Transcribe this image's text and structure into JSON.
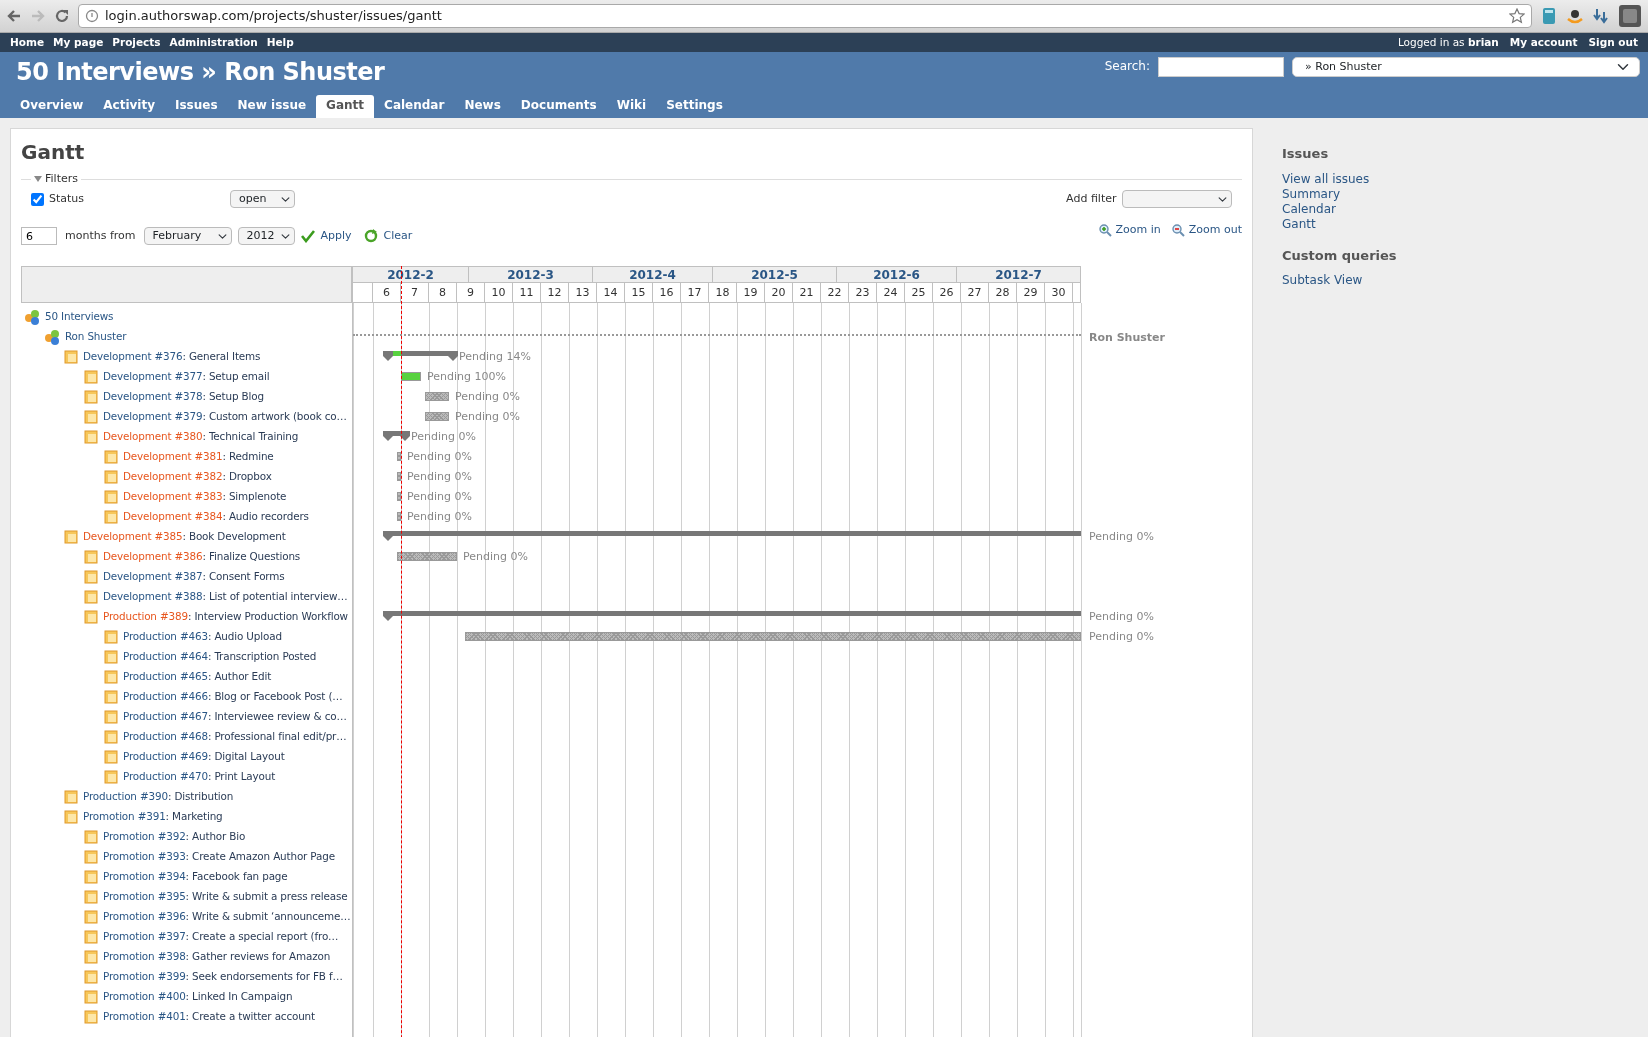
{
  "browser": {
    "url": "login.authorswap.com/projects/shuster/issues/gantt"
  },
  "top_menu": {
    "items": [
      "Home",
      "My page",
      "Projects",
      "Administration",
      "Help"
    ],
    "logged_in": "Logged in as **brian**",
    "account_items": [
      "My account",
      "Sign out"
    ]
  },
  "header": {
    "title": "50 Interviews » Ron Shuster",
    "search_label": "Search:",
    "project_jump": "» Ron Shuster"
  },
  "tabs": [
    {
      "label": "Overview",
      "selected": false
    },
    {
      "label": "Activity",
      "selected": false
    },
    {
      "label": "Issues",
      "selected": false
    },
    {
      "label": "New issue",
      "selected": false
    },
    {
      "label": "Gantt",
      "selected": true
    },
    {
      "label": "Calendar",
      "selected": false
    },
    {
      "label": "News",
      "selected": false
    },
    {
      "label": "Documents",
      "selected": false
    },
    {
      "label": "Wiki",
      "selected": false
    },
    {
      "label": "Settings",
      "selected": false
    }
  ],
  "page": {
    "title": "Gantt",
    "filters": {
      "legend": "Filters",
      "expanded": true,
      "status": {
        "label": "Status",
        "checked": true,
        "value": "open"
      },
      "add_filter_label": "Add filter"
    },
    "range": {
      "count": "6",
      "label": "months from",
      "month": "February",
      "year": "2012"
    },
    "apply": "Apply",
    "clear": "Clear",
    "zoom_in": "Zoom in",
    "zoom_out": "Zoom out"
  },
  "gantt": {
    "months": [
      "2012-2",
      "2012-3",
      "2012-4",
      "2012-5",
      "2012-6",
      "2012-7"
    ],
    "weeks": [
      "6",
      "7",
      "8",
      "9",
      "10",
      "11",
      "12",
      "13",
      "14",
      "15",
      "16",
      "17",
      "18",
      "19",
      "20",
      "21",
      "22",
      "23",
      "24",
      "25",
      "26",
      "27",
      "28",
      "29",
      "30"
    ],
    "rows": [
      {
        "kind": "project",
        "name": "50 Interviews",
        "children": [
          {
            "kind": "project",
            "name": "Ron Shuster",
            "bar": {
              "kind": "project",
              "label": "Ron Shuster"
            },
            "children": [
              {
                "kind": "issue",
                "link": "Development #376",
                "subject": ": General Items",
                "overdue": false,
                "bar": {
                  "kind": "parent",
                  "level": 0.14,
                  "label": "Pending 14%"
                },
                "children": [
                  {
                    "kind": "issue",
                    "link": "Development #377",
                    "subject": ": Setup email",
                    "overdue": false,
                    "bar": {
                      "kind": "task",
                      "level": 1,
                      "label": "Pending 100%"
                    }
                  },
                  {
                    "kind": "issue",
                    "link": "Development #378",
                    "subject": ": Setup Blog",
                    "overdue": false,
                    "bar": {
                      "kind": "task",
                      "level": 0,
                      "label": "Pending 0%"
                    }
                  },
                  {
                    "kind": "issue",
                    "link": "Development #379",
                    "subject": ": Custom artwork (book co…",
                    "overdue": false,
                    "bar": {
                      "kind": "task",
                      "level": 0,
                      "label": "Pending 0%"
                    }
                  },
                  {
                    "kind": "issue",
                    "link": "Development #380",
                    "subject": ": Technical Training",
                    "overdue": true,
                    "bar": {
                      "kind": "parent",
                      "level": 0,
                      "label": "Pending 0%"
                    },
                    "children": [
                      {
                        "kind": "issue",
                        "link": "Development #381",
                        "subject": ": Redmine",
                        "overdue": true,
                        "bar": {
                          "kind": "task",
                          "label": "Pending 0%"
                        }
                      },
                      {
                        "kind": "issue",
                        "link": "Development #382",
                        "subject": ": Dropbox",
                        "overdue": true,
                        "bar": {
                          "kind": "task",
                          "label": "Pending 0%"
                        }
                      },
                      {
                        "kind": "issue",
                        "link": "Development #383",
                        "subject": ": Simplenote",
                        "overdue": true,
                        "bar": {
                          "kind": "task",
                          "label": "Pending 0%"
                        }
                      },
                      {
                        "kind": "issue",
                        "link": "Development #384",
                        "subject": ": Audio recorders",
                        "overdue": true,
                        "bar": {
                          "kind": "task",
                          "label": "Pending 0%"
                        }
                      }
                    ]
                  }
                ]
              },
              {
                "kind": "issue",
                "link": "Development #385",
                "subject": ": Book Development",
                "overdue": true,
                "bar": {
                  "kind": "parent",
                  "level": 0,
                  "label": "Pending 0%"
                },
                "children": [
                  {
                    "kind": "issue",
                    "link": "Development #386",
                    "subject": ": Finalize Questions",
                    "overdue": true,
                    "bar": {
                      "kind": "task",
                      "level": 0,
                      "label": "Pending 0%"
                    }
                  },
                  {
                    "kind": "issue",
                    "link": "Development #387",
                    "subject": ": Consent Forms",
                    "overdue": false
                  },
                  {
                    "kind": "issue",
                    "link": "Development #388",
                    "subject": ": List of potential interview…",
                    "overdue": false
                  },
                  {
                    "kind": "issue",
                    "link": "Production #389",
                    "subject": ": Interview Production Workflow",
                    "overdue": true,
                    "bar": {
                      "kind": "parent",
                      "level": 0,
                      "label": "Pending 0%"
                    },
                    "children": [
                      {
                        "kind": "issue",
                        "link": "Production #463",
                        "subject": ": Audio Upload",
                        "overdue": false,
                        "bar": {
                          "kind": "task",
                          "level": 0,
                          "label": "Pending 0%"
                        }
                      },
                      {
                        "kind": "issue",
                        "link": "Production #464",
                        "subject": ": Transcription Posted",
                        "overdue": false
                      },
                      {
                        "kind": "issue",
                        "link": "Production #465",
                        "subject": ": Author Edit",
                        "overdue": false
                      },
                      {
                        "kind": "issue",
                        "link": "Production #466",
                        "subject": ": Blog or Facebook Post (…",
                        "overdue": false
                      },
                      {
                        "kind": "issue",
                        "link": "Production #467",
                        "subject": ": Interviewee review & co…",
                        "overdue": false
                      },
                      {
                        "kind": "issue",
                        "link": "Production #468",
                        "subject": ": Professional final edit/pr…",
                        "overdue": false
                      },
                      {
                        "kind": "issue",
                        "link": "Production #469",
                        "subject": ": Digital Layout",
                        "overdue": false
                      },
                      {
                        "kind": "issue",
                        "link": "Production #470",
                        "subject": ": Print Layout",
                        "overdue": false
                      }
                    ]
                  }
                ]
              },
              {
                "kind": "issue",
                "link": "Production #390",
                "subject": ": Distribution",
                "overdue": false
              },
              {
                "kind": "issue",
                "link": "Promotion #391",
                "subject": ": Marketing",
                "overdue": false,
                "children": [
                  {
                    "kind": "issue",
                    "link": "Promotion #392",
                    "subject": ": Author Bio",
                    "overdue": false
                  },
                  {
                    "kind": "issue",
                    "link": "Promotion #393",
                    "subject": ": Create Amazon Author Page",
                    "overdue": false
                  },
                  {
                    "kind": "issue",
                    "link": "Promotion #394",
                    "subject": ": Facebook fan page",
                    "overdue": false
                  },
                  {
                    "kind": "issue",
                    "link": "Promotion #395",
                    "subject": ": Write & submit a press release",
                    "overdue": false
                  },
                  {
                    "kind": "issue",
                    "link": "Promotion #396",
                    "subject": ": Write & submit ‘announceme…",
                    "overdue": false
                  },
                  {
                    "kind": "issue",
                    "link": "Promotion #397",
                    "subject": ": Create a special report (fro…",
                    "overdue": false
                  },
                  {
                    "kind": "issue",
                    "link": "Promotion #398",
                    "subject": ": Gather reviews for Amazon",
                    "overdue": false
                  },
                  {
                    "kind": "issue",
                    "link": "Promotion #399",
                    "subject": ": Seek endorsements for FB f…",
                    "overdue": false
                  },
                  {
                    "kind": "issue",
                    "link": "Promotion #400",
                    "subject": ": Linked In Campaign",
                    "overdue": false
                  },
                  {
                    "kind": "issue",
                    "link": "Promotion #401",
                    "subject": ": Create a twitter account",
                    "overdue": false
                  }
                ]
              }
            ]
          }
        ]
      }
    ]
  },
  "sidebar": {
    "sections": [
      {
        "title": "Issues",
        "links": [
          "View all issues",
          "Summary",
          "Calendar",
          "Gantt"
        ]
      },
      {
        "title": "Custom queries",
        "links": [
          "Subtask View"
        ]
      }
    ]
  }
}
